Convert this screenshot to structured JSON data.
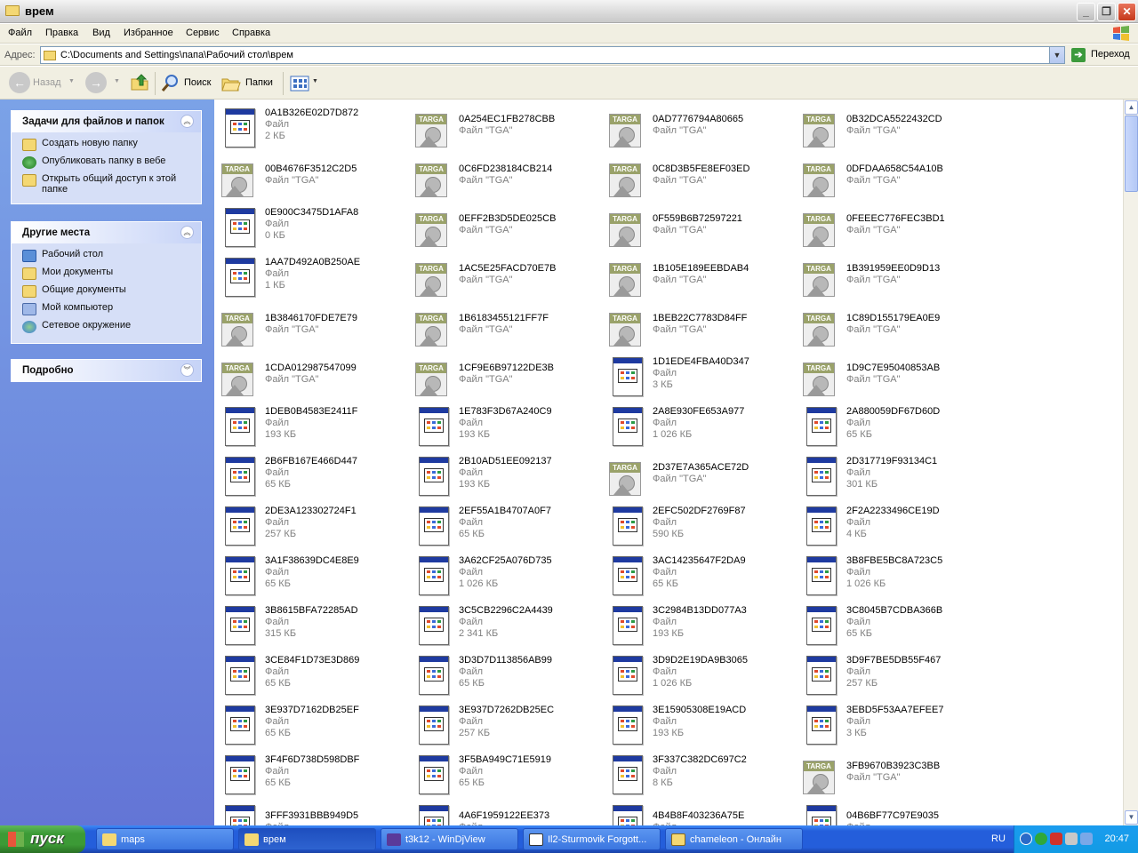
{
  "window": {
    "title": "врем"
  },
  "menu": [
    "Файл",
    "Правка",
    "Вид",
    "Избранное",
    "Сервис",
    "Справка"
  ],
  "address": {
    "label": "Адрес:",
    "path": "C:\\Documents and Settings\\папа\\Рабочий стол\\врем",
    "go": "Переход"
  },
  "toolbar": {
    "back": "Назад",
    "search": "Поиск",
    "folders": "Папки"
  },
  "sidebar": {
    "tasks": {
      "title": "Задачи для файлов и папок",
      "items": [
        "Создать новую папку",
        "Опубликовать папку в вебе",
        "Открыть общий доступ к этой папке"
      ]
    },
    "places": {
      "title": "Другие места",
      "items": [
        "Рабочий стол",
        "Мои документы",
        "Общие документы",
        "Мой компьютер",
        "Сетевое окружение"
      ]
    },
    "details": {
      "title": "Подробно"
    }
  },
  "files": [
    {
      "name": "0A1B326E02D7D872",
      "type": "Файл",
      "size": "2 КБ",
      "icon": "doc"
    },
    {
      "name": "0A254EC1FB278CBB",
      "type": "Файл \"TGA\"",
      "size": "",
      "icon": "tga"
    },
    {
      "name": "0AD7776794A80665",
      "type": "Файл \"TGA\"",
      "size": "",
      "icon": "tga"
    },
    {
      "name": "0B32DCA5522432CD",
      "type": "Файл \"TGA\"",
      "size": "",
      "icon": "tga"
    },
    {
      "name": "00B4676F3512C2D5",
      "type": "Файл \"TGA\"",
      "size": "",
      "icon": "tga"
    },
    {
      "name": "0C6FD238184CB214",
      "type": "Файл \"TGA\"",
      "size": "",
      "icon": "tga"
    },
    {
      "name": "0C8D3B5FE8EF03ED",
      "type": "Файл \"TGA\"",
      "size": "",
      "icon": "tga"
    },
    {
      "name": "0DFDAA658C54A10B",
      "type": "Файл \"TGA\"",
      "size": "",
      "icon": "tga"
    },
    {
      "name": "0E900C3475D1AFA8",
      "type": "Файл",
      "size": "0 КБ",
      "icon": "doc"
    },
    {
      "name": "0EFF2B3D5DE025CB",
      "type": "Файл \"TGA\"",
      "size": "",
      "icon": "tga"
    },
    {
      "name": "0F559B6B72597221",
      "type": "Файл \"TGA\"",
      "size": "",
      "icon": "tga"
    },
    {
      "name": "0FEEEC776FEC3BD1",
      "type": "Файл \"TGA\"",
      "size": "",
      "icon": "tga"
    },
    {
      "name": "1AA7D492A0B250AE",
      "type": "Файл",
      "size": "1 КБ",
      "icon": "doc"
    },
    {
      "name": "1AC5E25FACD70E7B",
      "type": "Файл \"TGA\"",
      "size": "",
      "icon": "tga"
    },
    {
      "name": "1B105E189EEBDAB4",
      "type": "Файл \"TGA\"",
      "size": "",
      "icon": "tga"
    },
    {
      "name": "1B391959EE0D9D13",
      "type": "Файл \"TGA\"",
      "size": "",
      "icon": "tga"
    },
    {
      "name": "1B3846170FDE7E79",
      "type": "Файл \"TGA\"",
      "size": "",
      "icon": "tga"
    },
    {
      "name": "1B6183455121FF7F",
      "type": "Файл \"TGA\"",
      "size": "",
      "icon": "tga"
    },
    {
      "name": "1BEB22C7783D84FF",
      "type": "Файл \"TGA\"",
      "size": "",
      "icon": "tga"
    },
    {
      "name": "1C89D155179EA0E9",
      "type": "Файл \"TGA\"",
      "size": "",
      "icon": "tga"
    },
    {
      "name": "1CDA012987547099",
      "type": "Файл \"TGA\"",
      "size": "",
      "icon": "tga"
    },
    {
      "name": "1CF9E6B97122DE3B",
      "type": "Файл \"TGA\"",
      "size": "",
      "icon": "tga"
    },
    {
      "name": "1D1EDE4FBA40D347",
      "type": "Файл",
      "size": "3 КБ",
      "icon": "doc"
    },
    {
      "name": "1D9C7E95040853AB",
      "type": "Файл \"TGA\"",
      "size": "",
      "icon": "tga"
    },
    {
      "name": "1DEB0B4583E2411F",
      "type": "Файл",
      "size": "193 КБ",
      "icon": "doc"
    },
    {
      "name": "1E783F3D67A240C9",
      "type": "Файл",
      "size": "193 КБ",
      "icon": "doc"
    },
    {
      "name": "2A8E930FE653A977",
      "type": "Файл",
      "size": "1 026 КБ",
      "icon": "doc"
    },
    {
      "name": "2A880059DF67D60D",
      "type": "Файл",
      "size": "65 КБ",
      "icon": "doc"
    },
    {
      "name": "2B6FB167E466D447",
      "type": "Файл",
      "size": "65 КБ",
      "icon": "doc"
    },
    {
      "name": "2B10AD51EE092137",
      "type": "Файл",
      "size": "193 КБ",
      "icon": "doc"
    },
    {
      "name": "2D37E7A365ACE72D",
      "type": "Файл \"TGA\"",
      "size": "",
      "icon": "tga"
    },
    {
      "name": "2D317719F93134C1",
      "type": "Файл",
      "size": "301 КБ",
      "icon": "doc"
    },
    {
      "name": "2DE3A123302724F1",
      "type": "Файл",
      "size": "257 КБ",
      "icon": "doc"
    },
    {
      "name": "2EF55A1B4707A0F7",
      "type": "Файл",
      "size": "65 КБ",
      "icon": "doc"
    },
    {
      "name": "2EFC502DF2769F87",
      "type": "Файл",
      "size": "590 КБ",
      "icon": "doc"
    },
    {
      "name": "2F2A2233496CE19D",
      "type": "Файл",
      "size": "4 КБ",
      "icon": "doc"
    },
    {
      "name": "3A1F38639DC4E8E9",
      "type": "Файл",
      "size": "65 КБ",
      "icon": "doc"
    },
    {
      "name": "3A62CF25A076D735",
      "type": "Файл",
      "size": "1 026 КБ",
      "icon": "doc"
    },
    {
      "name": "3AC14235647F2DA9",
      "type": "Файл",
      "size": "65 КБ",
      "icon": "doc"
    },
    {
      "name": "3B8FBE5BC8A723C5",
      "type": "Файл",
      "size": "1 026 КБ",
      "icon": "doc"
    },
    {
      "name": "3B8615BFA72285AD",
      "type": "Файл",
      "size": "315 КБ",
      "icon": "doc"
    },
    {
      "name": "3C5CB2296C2A4439",
      "type": "Файл",
      "size": "2 341 КБ",
      "icon": "doc"
    },
    {
      "name": "3C2984B13DD077A3",
      "type": "Файл",
      "size": "193 КБ",
      "icon": "doc"
    },
    {
      "name": "3C8045B7CDBA366B",
      "type": "Файл",
      "size": "65 КБ",
      "icon": "doc"
    },
    {
      "name": "3CE84F1D73E3D869",
      "type": "Файл",
      "size": "65 КБ",
      "icon": "doc"
    },
    {
      "name": "3D3D7D113856AB99",
      "type": "Файл",
      "size": "65 КБ",
      "icon": "doc"
    },
    {
      "name": "3D9D2E19DA9B3065",
      "type": "Файл",
      "size": "1 026 КБ",
      "icon": "doc"
    },
    {
      "name": "3D9F7BE5DB55F467",
      "type": "Файл",
      "size": "257 КБ",
      "icon": "doc"
    },
    {
      "name": "3E937D7162DB25EF",
      "type": "Файл",
      "size": "65 КБ",
      "icon": "doc"
    },
    {
      "name": "3E937D7262DB25EC",
      "type": "Файл",
      "size": "257 КБ",
      "icon": "doc"
    },
    {
      "name": "3E15905308E19ACD",
      "type": "Файл",
      "size": "193 КБ",
      "icon": "doc"
    },
    {
      "name": "3EBD5F53AA7EFEE7",
      "type": "Файл",
      "size": "3 КБ",
      "icon": "doc"
    },
    {
      "name": "3F4F6D738D598DBF",
      "type": "Файл",
      "size": "65 КБ",
      "icon": "doc"
    },
    {
      "name": "3F5BA949C71E5919",
      "type": "Файл",
      "size": "65 КБ",
      "icon": "doc"
    },
    {
      "name": "3F337C382DC697C2",
      "type": "Файл",
      "size": "8 КБ",
      "icon": "doc"
    },
    {
      "name": "3FB9670B3923C3BB",
      "type": "Файл \"TGA\"",
      "size": "",
      "icon": "tga"
    },
    {
      "name": "3FFF3931BBB949D5",
      "type": "Файл",
      "size": "",
      "icon": "doc"
    },
    {
      "name": "4A6F1959122EE373",
      "type": "Файл",
      "size": "",
      "icon": "doc"
    },
    {
      "name": "4B4B8F403236A75E",
      "type": "Файл",
      "size": "",
      "icon": "doc"
    },
    {
      "name": "04B6BF77C97E9035",
      "type": "Файл",
      "size": "",
      "icon": "doc"
    }
  ],
  "taskbar": {
    "start": "пуск",
    "tasks": [
      "maps",
      "врем",
      "t3k12 - WinDjView",
      "Il2-Sturmovik Forgott...",
      "chameleon - Онлайн"
    ],
    "lang": "RU",
    "clock": "20:47"
  }
}
